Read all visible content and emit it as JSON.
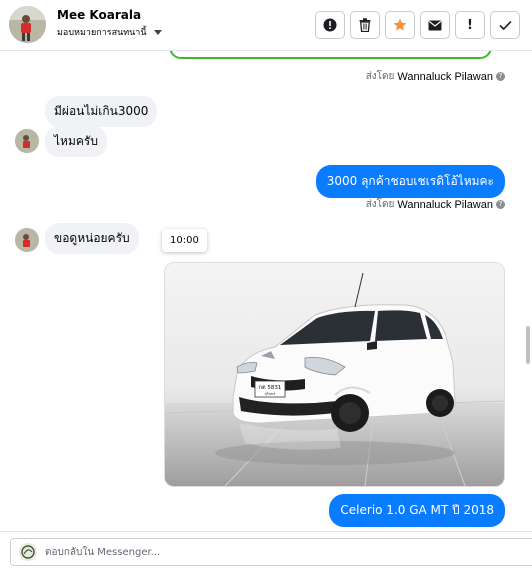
{
  "header": {
    "name": "Mee Koarala",
    "assign_label": "มอบหมายการสนทนานี้",
    "actions": [
      {
        "icon": "alert-circle-icon",
        "glyph": "!"
      },
      {
        "icon": "trash-icon",
        "glyph": "🗑"
      },
      {
        "icon": "star-icon",
        "glyph": "★"
      },
      {
        "icon": "envelope-icon",
        "glyph": "✉"
      },
      {
        "icon": "exclamation-icon",
        "glyph": "!"
      },
      {
        "icon": "check-icon",
        "glyph": "✓"
      }
    ],
    "star_color": "#f7923a"
  },
  "messages": {
    "sent_prefix": "ส่งโดย",
    "agent": "Wannaluck Pilawan",
    "in_1": "มีผ่อนไม่เกิน3000",
    "in_2": "ไหมครับ",
    "out_1": "3000  ลุกค้าชอบเชเรดิโอ้ไหมคะ",
    "in_3": "ขอดูหน่อยครับ",
    "tooltip_time": "10:00",
    "out_2": "Celerio 1.0 GA MT ปี 2018",
    "plate_line1": "กต 5831",
    "plate_line2": "สุรินทร์"
  },
  "footer": {
    "reply_placeholder": "ตอบกลับใน Messenger..."
  },
  "colors": {
    "outgoing_bubble": "#0a7cff",
    "incoming_bubble": "#f0f2f5",
    "top_outline": "#42b72a"
  }
}
